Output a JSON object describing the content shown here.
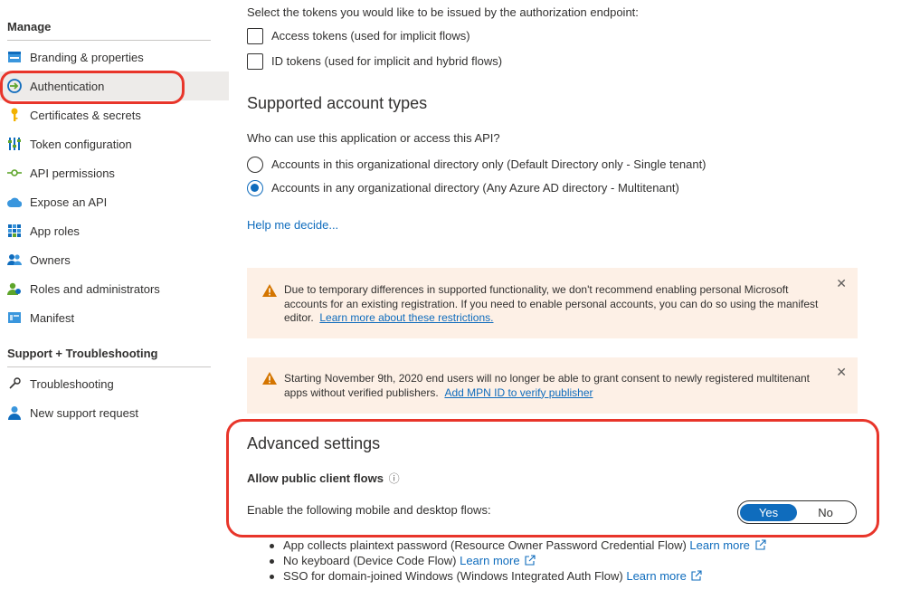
{
  "sidebar": {
    "manage_title": "Manage",
    "manage_items": [
      {
        "label": "Branding & properties",
        "icon": "branding-icon"
      },
      {
        "label": "Authentication",
        "icon": "authentication-icon",
        "active": true
      },
      {
        "label": "Certificates & secrets",
        "icon": "key-icon"
      },
      {
        "label": "Token configuration",
        "icon": "token-config-icon"
      },
      {
        "label": "API permissions",
        "icon": "api-permissions-icon"
      },
      {
        "label": "Expose an API",
        "icon": "cloud-icon"
      },
      {
        "label": "App roles",
        "icon": "app-roles-icon"
      },
      {
        "label": "Owners",
        "icon": "owners-icon"
      },
      {
        "label": "Roles and administrators",
        "icon": "roles-admins-icon"
      },
      {
        "label": "Manifest",
        "icon": "manifest-icon"
      }
    ],
    "support_title": "Support + Troubleshooting",
    "support_items": [
      {
        "label": "Troubleshooting",
        "icon": "wrench-icon"
      },
      {
        "label": "New support request",
        "icon": "support-person-icon"
      }
    ]
  },
  "tokens": {
    "intro": "Select the tokens you would like to be issued by the authorization endpoint:",
    "access_tokens_label": "Access tokens (used for implicit flows)",
    "id_tokens_label": "ID tokens (used for implicit and hybrid flows)"
  },
  "account_types": {
    "heading": "Supported account types",
    "question": "Who can use this application or access this API?",
    "option_single": "Accounts in this organizational directory only (Default Directory only - Single tenant)",
    "option_multi": "Accounts in any organizational directory (Any Azure AD directory - Multitenant)",
    "selected": "multi",
    "help_link": "Help me decide..."
  },
  "warnings": {
    "personal_accounts": {
      "line1": "Due to temporary differences in supported functionality, we don't recommend enabling personal Microsoft",
      "line2": "accounts for an existing registration. If you need to enable personal accounts, you can do so using the manifest",
      "line3_prefix": "editor.",
      "link": "Learn more about these restrictions.",
      "close": "✕"
    },
    "publisher": {
      "line1": "Starting November 9th, 2020 end users will no longer be able to grant consent to newly registered multitenant",
      "line2_prefix": "apps without verified publishers.",
      "link": "Add MPN ID to verify publisher",
      "close": "✕"
    }
  },
  "advanced": {
    "heading": "Advanced settings",
    "public_client_label": "Allow public client flows",
    "info_icon": "ⓘ",
    "flows_label": "Enable the following mobile and desktop flows:",
    "toggle_yes": "Yes",
    "toggle_no": "No",
    "toggle_value": "Yes",
    "flows": [
      {
        "text": "App collects plaintext password (Resource Owner Password Credential Flow)",
        "link": "Learn more"
      },
      {
        "text": "No keyboard (Device Code Flow)",
        "link": "Learn more"
      },
      {
        "text": "SSO for domain-joined Windows (Windows Integrated Auth Flow)",
        "link": "Learn more"
      }
    ]
  },
  "colors": {
    "accent": "#0f6cbd",
    "highlight": "#e8352a",
    "warning_bg": "#fdf0e6",
    "warning_icon": "#d47500"
  }
}
